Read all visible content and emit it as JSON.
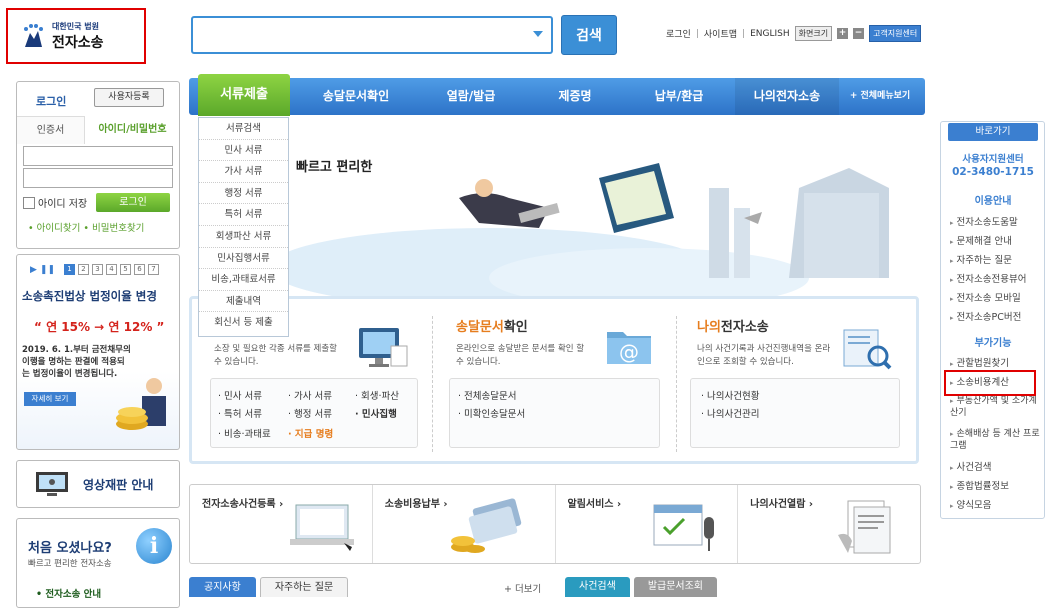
{
  "logo": {
    "court": "대한민국 법원",
    "name": "전자소송"
  },
  "search": {
    "button": "검색",
    "placeholder": ""
  },
  "toplinks": {
    "login": "로그인",
    "sitemap": "사이트맵",
    "english": "ENGLISH",
    "zoom": "화면크기",
    "plus": "+",
    "minus": "−",
    "support": "고객지원센터"
  },
  "nav": {
    "items": [
      "서류제출",
      "송달문서확인",
      "열람/발급",
      "제증명",
      "납부/환급",
      "나의전자소송"
    ],
    "all_menu": "+ 전체메뉴보기"
  },
  "dropdown": [
    "서류검색",
    "민사 서류",
    "가사 서류",
    "행정 서류",
    "특허 서류",
    "회생파산 서류",
    "민사집행서류",
    "비송,과태료서류",
    "제출내역",
    "회신서 등 제출"
  ],
  "login": {
    "title": "로그인",
    "register": "사용자등록",
    "tab_cert": "인증서",
    "tab_id": "아이디/비밀번호",
    "save_id": "아이디 저장",
    "login_button": "로그인",
    "find_id": "• 아이디찾기",
    "find_pw": "• 비밀번호찾기"
  },
  "banner": {
    "pages": [
      "1",
      "2",
      "3",
      "4",
      "5",
      "6",
      "7"
    ],
    "title": "소송촉진법상 법정이율 변경",
    "rate": "“ 연 15% → 연 12% ”",
    "desc": "2019. 6. 1.부터 금전채무의 이행을 명하는 판결에 적용되는 법정이율이 변경됩니다.",
    "more": "자세히 보기"
  },
  "video": {
    "label": "영상재판 안내"
  },
  "first": {
    "title": "처음 오셨나요?",
    "sub": "빠르고 편리한 전자소송",
    "link": "• 전자소송 안내"
  },
  "hero": {
    "text": "빠르고 편리한"
  },
  "services": {
    "s1": {
      "desc": "소장 및 필요한 각종 서류를 제출할 수 있습니다.",
      "links": [
        "· 민사 서류",
        "· 가사 서류",
        "· 회생·파산",
        "· 특허 서류",
        "· 행정 서류",
        "· 민사집행",
        "· 비송·과태료",
        "· 지급 명령"
      ]
    },
    "s2": {
      "title_a": "송달문서",
      "title_b": "확인",
      "desc": "온라인으로 송달받은 문서를 확인 할 수 있습니다.",
      "links": [
        "· 전체송달문서",
        "· 미확인송달문서"
      ]
    },
    "s3": {
      "title_a": "나의",
      "title_b": "전자소송",
      "desc": "나의 사건기록과 사건진행내역을 온라인으로 조회할 수 있습니다.",
      "links": [
        "· 나의사건현황",
        "· 나의사건관리"
      ]
    }
  },
  "bottom": [
    "전자소송사건등록 ›",
    "소송비용납부 ›",
    "알림서비스 ›",
    "나의사건열람 ›"
  ],
  "notice": {
    "tabs": [
      "공지사항",
      "자주하는 질문"
    ],
    "more": "+ 더보기"
  },
  "case": {
    "tabs": [
      "사건검색",
      "발급문서조회"
    ]
  },
  "quick": {
    "head": "바로가기",
    "center": "사용자지원센터",
    "phone": "02-3480-1715",
    "guide_title": "이용안내",
    "guide": [
      "전자소송도움말",
      "문제해결 안내",
      "자주하는 질문",
      "전자소송전용뷰어",
      "전자소송 모바일",
      "전자소송PC버전"
    ],
    "extra_title": "부가기능",
    "extra": [
      "관할법원찾기",
      "소송비용계산",
      "부동산가액 및 소가계산기",
      "손해배상 등 계산 프로그램",
      "사건검색",
      "종합법률정보",
      "양식모음"
    ]
  },
  "colors": {
    "primary": "#3b8fd6",
    "green": "#6cb534",
    "highlight": "#e00000",
    "orange": "#e67d1e"
  }
}
